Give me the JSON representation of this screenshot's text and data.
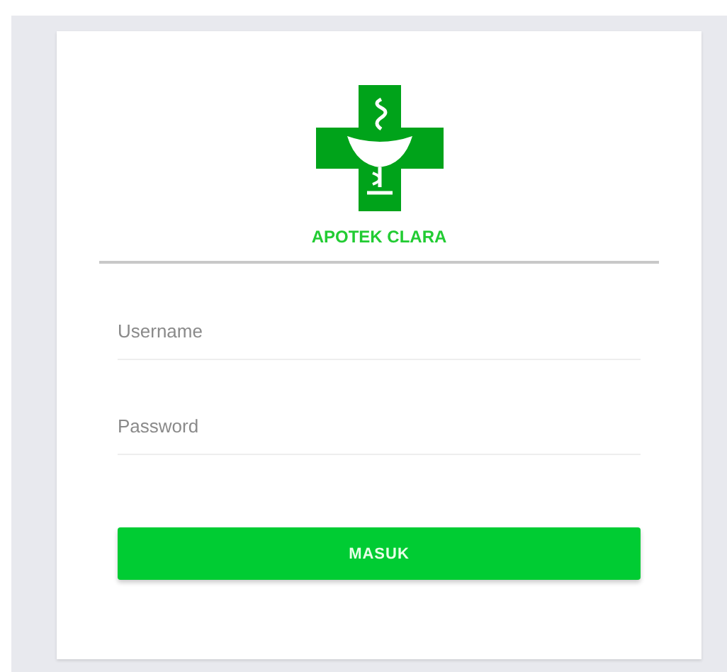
{
  "brand": {
    "name": "APOTEK CLARA"
  },
  "fields": [
    {
      "placeholder": "Username"
    },
    {
      "placeholder": "Password"
    }
  ],
  "button": {
    "label": "MASUK"
  }
}
